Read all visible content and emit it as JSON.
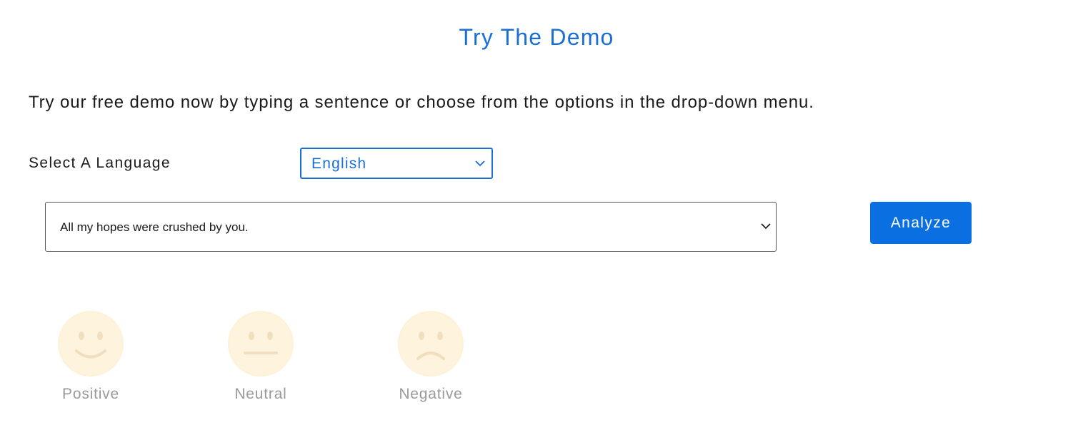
{
  "header": {
    "title": "Try The Demo"
  },
  "intro": {
    "text": "Try our free demo now by typing a sentence or choose from the options in the drop-down menu."
  },
  "language": {
    "label": "Select A Language",
    "selected": "English"
  },
  "sentence": {
    "selected": "All my hopes were crushed by you."
  },
  "actions": {
    "analyze_label": "Analyze"
  },
  "sentiments": [
    {
      "label": "Positive",
      "icon": "smile-icon"
    },
    {
      "label": "Neutral",
      "icon": "neutral-face-icon"
    },
    {
      "label": "Negative",
      "icon": "frown-icon"
    }
  ],
  "colors": {
    "accent": "#1a6fd4",
    "button": "#0a6fe0",
    "emoji_face": "#fdf1d8",
    "emoji_features": "#f0dfbe",
    "sentiment_label": "#9a9a9a"
  }
}
